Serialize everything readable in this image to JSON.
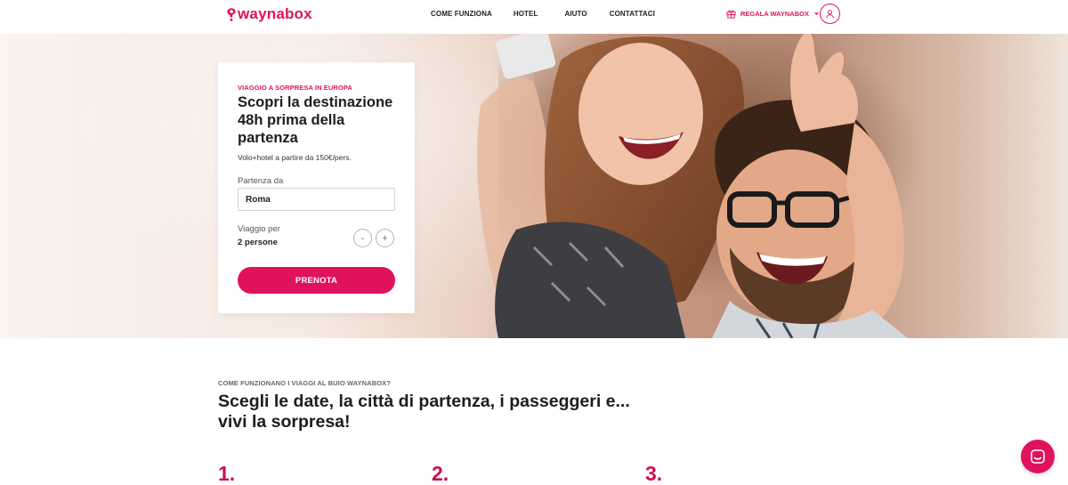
{
  "header": {
    "logo_text": "waynabox",
    "nav": [
      "COME FUNZIONA",
      "HOTEL",
      "AIUTO",
      "CONTATTACI"
    ],
    "gift_label": "REGALA WAYNABOX",
    "gift_icon": "gift-icon",
    "user_icon": "user-icon"
  },
  "hero": {
    "kicker": "VIAGGIO A SORPRESA IN EUROPA",
    "title": "Scopri la destinazione 48h prima della partenza",
    "subtitle": "Volo+hotel a partire da 150€/pers.",
    "departure_label": "Partenza da",
    "departure_value": "Roma",
    "travelers_label": "Viaggio per",
    "travelers_value": "2 persone",
    "minus_label": "-",
    "plus_label": "+",
    "book_label": "PRENOTA"
  },
  "how": {
    "kicker": "COME FUNZIONANO I VIAGGI AL BUIO WAYNABOX?",
    "title": "Scegli le date, la città di partenza, i passeggeri e... vivi la sorpresa!",
    "steps": [
      "1.",
      "2.",
      "3."
    ]
  },
  "colors": {
    "brand": "#e0125e"
  }
}
